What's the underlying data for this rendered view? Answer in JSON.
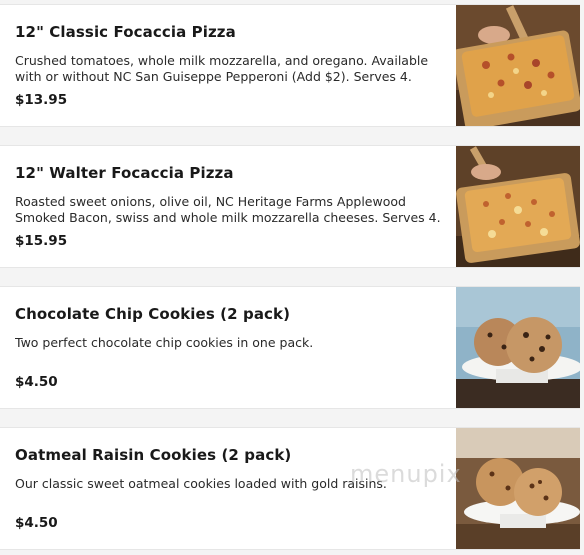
{
  "items": [
    {
      "title": "12\" Classic Focaccia Pizza",
      "description": "Crushed tomatoes, whole milk mozzarella, and oregano. Available with or without NC San Guiseppe Pepperoni (Add $2). Serves 4.",
      "price": "$13.95",
      "image": "focaccia-pizza-photo"
    },
    {
      "title": "12\" Walter Focaccia Pizza",
      "description": "Roasted sweet onions, olive oil, NC Heritage Farms Applewood Smoked Bacon, swiss and whole milk mozzarella cheeses. Serves 4.",
      "price": "$15.95",
      "image": "focaccia-pizza-photo"
    },
    {
      "title": "Chocolate Chip Cookies (2 pack)",
      "description": "Two perfect chocolate chip cookies in one pack.",
      "price": "$4.50",
      "image": "chocolate-chip-cookies-photo"
    },
    {
      "title": "Oatmeal Raisin Cookies (2 pack)",
      "description": "Our classic sweet oatmeal cookies loaded with gold raisins.",
      "price": "$4.50",
      "image": "oatmeal-raisin-cookies-photo"
    }
  ],
  "watermark": "menupix"
}
